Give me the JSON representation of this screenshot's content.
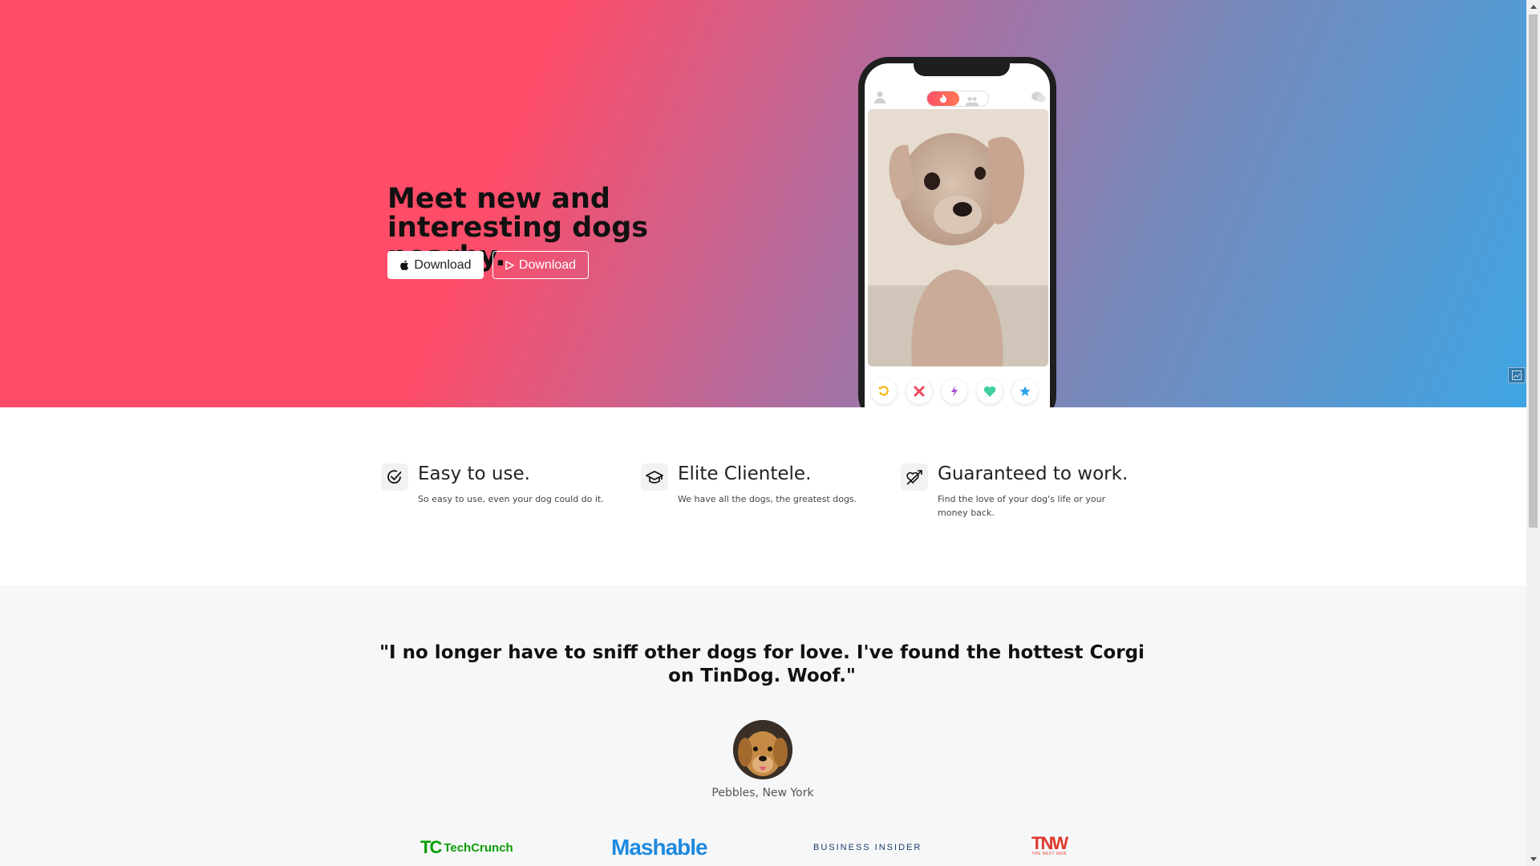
{
  "hero": {
    "title": "Meet new and interesting dogs nearby.",
    "download_apple_label": "Download",
    "download_play_label": "Download",
    "gradient_colors": [
      "#ff4c68",
      "#b06d9f",
      "#3ea5e3"
    ]
  },
  "phone": {
    "action_icons": [
      "rewind-icon",
      "nope-icon",
      "boost-icon",
      "like-icon",
      "superlike-icon"
    ]
  },
  "features": [
    {
      "icon": "check-circle-icon",
      "title": "Easy to use.",
      "text": "So easy to use, even your dog could do it."
    },
    {
      "icon": "graduation-cap-icon",
      "title": "Elite Clientele.",
      "text": "We have all the dogs, the greatest dogs."
    },
    {
      "icon": "heart-arrow-icon",
      "title": "Guaranteed to work.",
      "text": "Find the love of your dog's life or your money back."
    }
  ],
  "testimonial": {
    "quote": "\"I no longer have to sniff other dogs for love. I've found the hottest Corgi on TinDog. Woof.\"",
    "author": "Pebbles, New York"
  },
  "press": {
    "techcrunch_mark": "TC",
    "techcrunch": "TechCrunch",
    "mashable": "Mashable",
    "business_insider": "BUSINESS INSIDER",
    "tnw": "TNW",
    "tnw_sub": "THE NEXT WEB"
  }
}
